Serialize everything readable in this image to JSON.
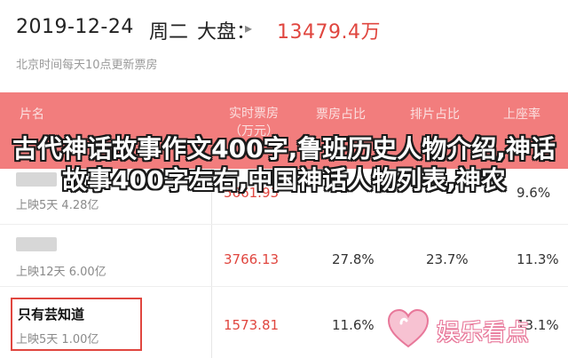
{
  "summary": {
    "date": "2019-12-24",
    "weekday": "周二",
    "market_label": "大盘：",
    "total_box_office": "13479.4万",
    "update_note": "北京时间每天10点更新票房"
  },
  "table": {
    "headers": {
      "name": "片名",
      "box_office": "实时票房（万元）",
      "box_share": "票房占比",
      "show_share": "排片占比",
      "seat_rate": "上座率"
    },
    "rows": [
      {
        "name": "",
        "release": "上映5天",
        "total": "4.28亿",
        "box_office": "5661.93",
        "box_share": "",
        "show_share": "",
        "seat_rate": "9.6%"
      },
      {
        "name": "",
        "release": "上映12天",
        "total": "6.00亿",
        "box_office": "3766.13",
        "box_share": "27.8%",
        "show_share": "23.7%",
        "seat_rate": "11.3%"
      },
      {
        "name": "只有芸知道",
        "release": "上映5天",
        "total": "1.00亿",
        "box_office": "1573.81",
        "box_share": "11.6%",
        "show_share": "",
        "seat_rate": "13.1%"
      }
    ]
  },
  "overlay_caption": "古代神话故事作文400字,鲁班历史人物介绍,神话故事400字左右,中国神话人物列表,神农",
  "watermark": {
    "text": "娱乐看点",
    "color": "#e8789a"
  },
  "colors": {
    "accent": "#e0463f",
    "header_bg": "#f27d7d"
  },
  "icons": {
    "chevron": "chevron-right-icon",
    "logo": "heart-logo-icon"
  }
}
